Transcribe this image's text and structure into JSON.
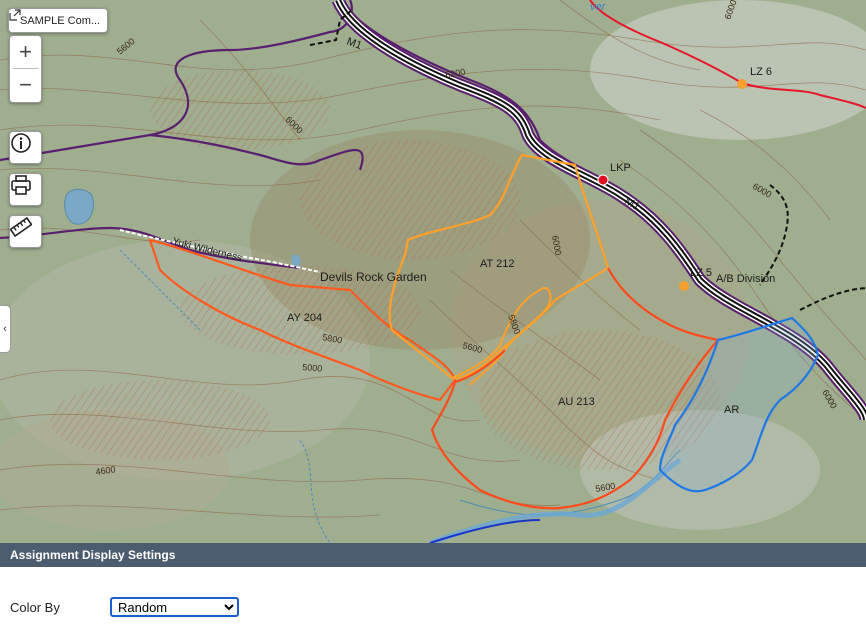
{
  "map": {
    "sample_button_label": "SAMPLE Com...",
    "zoom_in_symbol": "+",
    "zoom_out_symbol": "−",
    "collapse_tab_symbol": "‹",
    "icons": [
      "expand-icon",
      "zoom-in-icon",
      "zoom-out-icon",
      "info-icon",
      "print-icon",
      "measure-ruler-icon"
    ],
    "labels": {
      "lz6": "LZ 6",
      "lz5": "LZ 5",
      "lkp": "LKP",
      "ab_division": "A/B Division",
      "devils_rock_garden": "Devils Rock Garden",
      "yuki_wilderness": "Yuki Wilderness",
      "m1_top": "M1",
      "m1_mid": "M1",
      "at212": "AT 212",
      "ay204": "AY 204",
      "au213": "AU 213",
      "ar": "AR",
      "river_partial": "ver"
    },
    "contour_labels": [
      "5600",
      "6000",
      "6200",
      "6000",
      "6000",
      "6000",
      "6000",
      "5800",
      "5600",
      "5000",
      "5800",
      "5600",
      "4600",
      "5200",
      "6000"
    ],
    "colors": {
      "assignment_ay204": "#ff5a1e",
      "assignment_at212": "#ffa028",
      "assignment_au213": "#ff4a1a",
      "assignment_ar": "#1e78e6",
      "road_casing": "#5a1f6e",
      "road": "#111111",
      "trail_red": "#e8142a",
      "lz_marker": "#f5a030",
      "lkp_marker": "#e01020"
    }
  },
  "panel": {
    "header": "Assignment Display Settings",
    "color_by_label": "Color By",
    "color_by_value": "Random"
  }
}
